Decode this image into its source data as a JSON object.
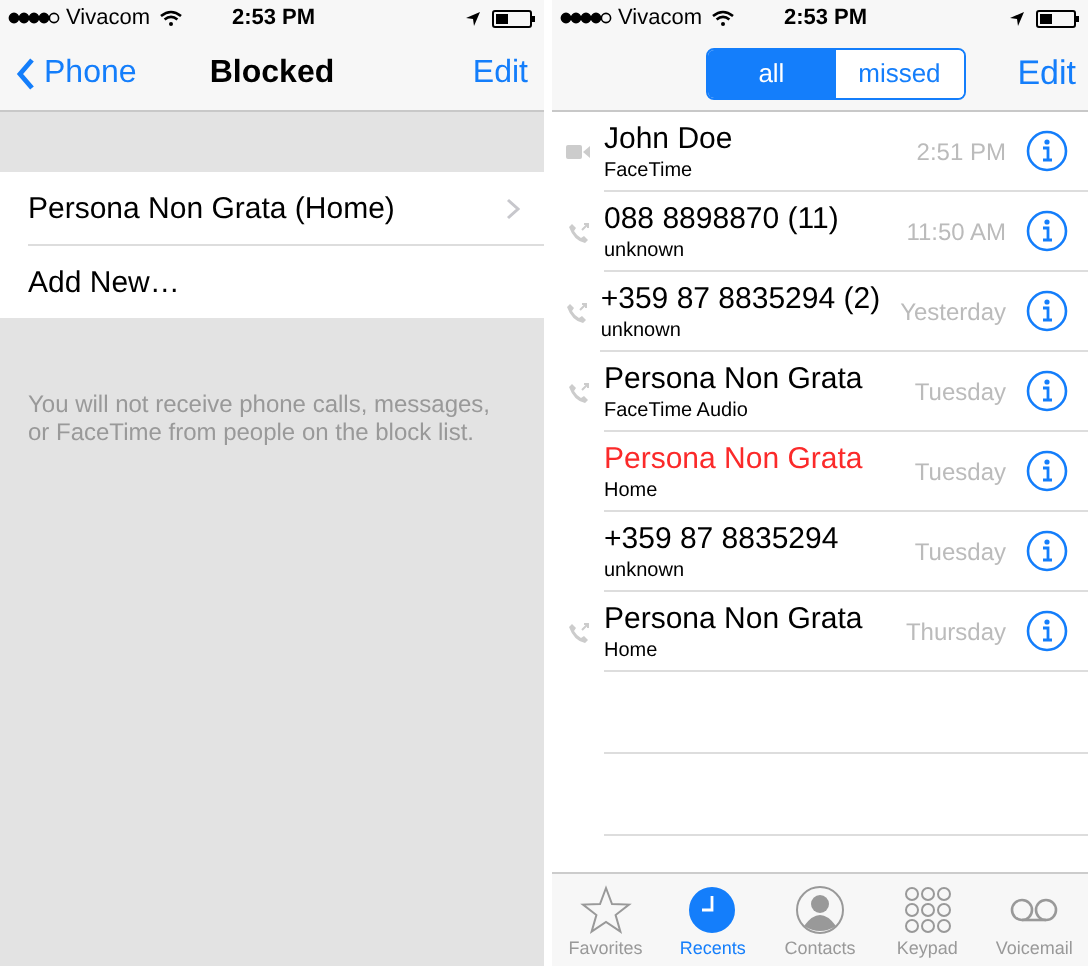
{
  "left": {
    "status_bar": {
      "carrier": "Vivacom",
      "time": "2:53 PM"
    },
    "nav": {
      "back": "Phone",
      "title": "Blocked",
      "action": "Edit"
    },
    "blocked": [
      {
        "label": "Persona Non Grata (Home)",
        "disclosure": true
      },
      {
        "label": "Add New…",
        "disclosure": false
      }
    ],
    "footer": "You will not receive phone calls, messages, or FaceTime from people on the block list."
  },
  "right": {
    "status_bar": {
      "carrier": "Vivacom",
      "time": "2:53 PM"
    },
    "segments": [
      {
        "label": "all",
        "selected": true
      },
      {
        "label": "missed",
        "selected": false
      }
    ],
    "action": "Edit",
    "calls": [
      {
        "name": "John Doe",
        "type": "FaceTime",
        "time": "2:51 PM",
        "kind": "video",
        "missed": false
      },
      {
        "name": "088 8898870  (11)",
        "type": "unknown",
        "time": "11:50 AM",
        "kind": "voice",
        "missed": false
      },
      {
        "name": "+359 87 8835294  (2)",
        "type": "unknown",
        "time": "Yesterday",
        "kind": "voice",
        "missed": false
      },
      {
        "name": "Persona Non Grata",
        "type": "FaceTime Audio",
        "time": "Tuesday",
        "kind": "voice",
        "missed": false
      },
      {
        "name": "Persona Non Grata",
        "type": "Home",
        "time": "Tuesday",
        "kind": "plain",
        "missed": true
      },
      {
        "name": "+359 87 8835294",
        "type": "unknown",
        "time": "Tuesday",
        "kind": "plain",
        "missed": false
      },
      {
        "name": "Persona Non Grata",
        "type": "Home",
        "time": "Thursday",
        "kind": "voice",
        "missed": false
      }
    ],
    "tabs": [
      {
        "label": "Favorites",
        "selected": false
      },
      {
        "label": "Recents",
        "selected": true
      },
      {
        "label": "Contacts",
        "selected": false
      },
      {
        "label": "Keypad",
        "selected": false
      },
      {
        "label": "Voicemail",
        "selected": false
      }
    ]
  }
}
